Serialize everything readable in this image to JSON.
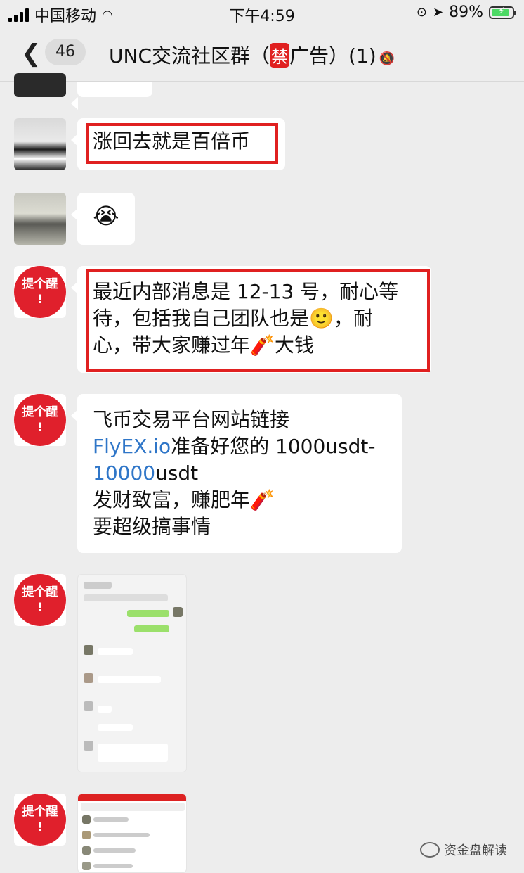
{
  "status_bar": {
    "carrier": "中国移动",
    "time": "下午4:59",
    "battery_percent": "89%",
    "battery_level": 0.89
  },
  "nav": {
    "unread_count": "46",
    "title_prefix": "UNC交流社区群（",
    "title_badge": "禁",
    "title_suffix": "广告）(1)"
  },
  "messages": [
    {
      "text": "涨回去就是百倍币"
    },
    {
      "emoji": "😭"
    },
    {
      "avatar_label": [
        "提个醒",
        "!"
      ],
      "lines": [
        "最近内部消息是 12-13 号，耐心等",
        "待，包括我自己团队也是🙂，耐",
        "心，带大家赚过年🧨大钱"
      ]
    },
    {
      "avatar_label": [
        "提个醒",
        "!"
      ],
      "line1": "飞币交易平台网站链接",
      "link1": "FlyEX.io",
      "line2_rest": "准备好您的 1000usdt-",
      "link2": "10000",
      "line3_rest": "usdt",
      "line4": "发财致富，赚肥年🧨",
      "line5": "要超级搞事情"
    },
    {
      "avatar_label": [
        "提个醒",
        "!"
      ]
    },
    {
      "avatar_label": [
        "提个醒",
        "!"
      ]
    }
  ],
  "watermark": "资金盘解读"
}
